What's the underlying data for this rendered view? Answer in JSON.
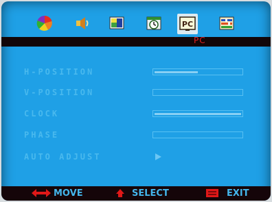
{
  "osd": {
    "title": "PC",
    "tabs": [
      {
        "name": "color",
        "icon": "color-wheel-icon"
      },
      {
        "name": "audio",
        "icon": "speaker-icon"
      },
      {
        "name": "picture",
        "icon": "picture-icon"
      },
      {
        "name": "time",
        "icon": "clock-icon"
      },
      {
        "name": "pc",
        "icon": "pc-icon",
        "label": "PC",
        "selected": true
      },
      {
        "name": "setup",
        "icon": "setup-icon"
      }
    ],
    "items": [
      {
        "label": "H-POSITION",
        "control": "slider",
        "value_percent": 50
      },
      {
        "label": "V-POSITION",
        "control": "slider",
        "value_percent": 0
      },
      {
        "label": "CLOCK",
        "control": "slider",
        "value_percent": 100
      },
      {
        "label": "PHASE",
        "control": "slider",
        "value_percent": 0
      },
      {
        "label": "AUTO ADJUST",
        "control": "arrow"
      }
    ],
    "footer": {
      "move": "MOVE",
      "select": "SELECT",
      "exit": "EXIT"
    },
    "colors": {
      "background": "#1fa0e6",
      "bar": "#120608",
      "title": "#e02020",
      "label": "#49b9ee",
      "footer_text": "#44b6ec",
      "footer_icons": "#e01818"
    }
  }
}
